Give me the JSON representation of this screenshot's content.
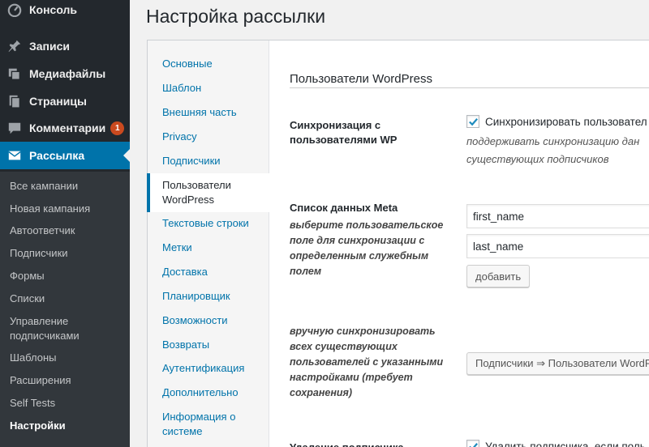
{
  "sidebar": {
    "menu": [
      {
        "label": "Консоль",
        "icon": "dashboard-icon"
      },
      {
        "label": "Записи",
        "icon": "pin-icon"
      },
      {
        "label": "Медиафайлы",
        "icon": "media-icon"
      },
      {
        "label": "Страницы",
        "icon": "pages-icon"
      },
      {
        "label": "Комментарии",
        "icon": "comment-icon",
        "badge": "1"
      },
      {
        "label": "Рассылка",
        "icon": "email-icon"
      }
    ],
    "submenu": [
      "Все кампании",
      "Новая кампания",
      "Автоответчик",
      "Подписчики",
      "Формы",
      "Списки",
      "Управление подписчиками",
      "Шаблоны",
      "Расширения",
      "Self Tests",
      "Настройки"
    ],
    "accent_color": "#0073aa",
    "badge_color": "#ca4a1f"
  },
  "page": {
    "title": "Настройка рассылки"
  },
  "tabs": [
    "Основные",
    "Шаблон",
    "Внешняя часть",
    "Privacy",
    "Подписчики",
    "Пользователи WordPress",
    "Текстовые строки",
    "Метки",
    "Доставка",
    "Планировщик",
    "Возможности",
    "Возвраты",
    "Аутентификация",
    "Дополнительно",
    "Информация о системе"
  ],
  "section": {
    "heading": "Пользователи WordPress",
    "sync": {
      "label": "Синхронизация с пользователями WP",
      "checkbox_label": "Синхронизировать пользовател",
      "checked": true,
      "description_line1": "поддерживать синхронизацию дан",
      "description_line2": "существующих подписчиков"
    },
    "meta": {
      "label": "Список данных Meta",
      "description": "выберите пользовательское поле для синхронизации с определенным служебным полем",
      "field1": "first_name",
      "field2": "last_name",
      "add_button": "добавить"
    },
    "manual": {
      "description": "вручную синхронизировать всех существующих пользователей с указанными настройками (требует сохранения)",
      "button": "Подписчики ⇒ Пользователи WordPr"
    },
    "cut_off": {
      "label": "Удаление подписчика",
      "checkbox_label": "Удалить подписчика, если поль"
    }
  }
}
